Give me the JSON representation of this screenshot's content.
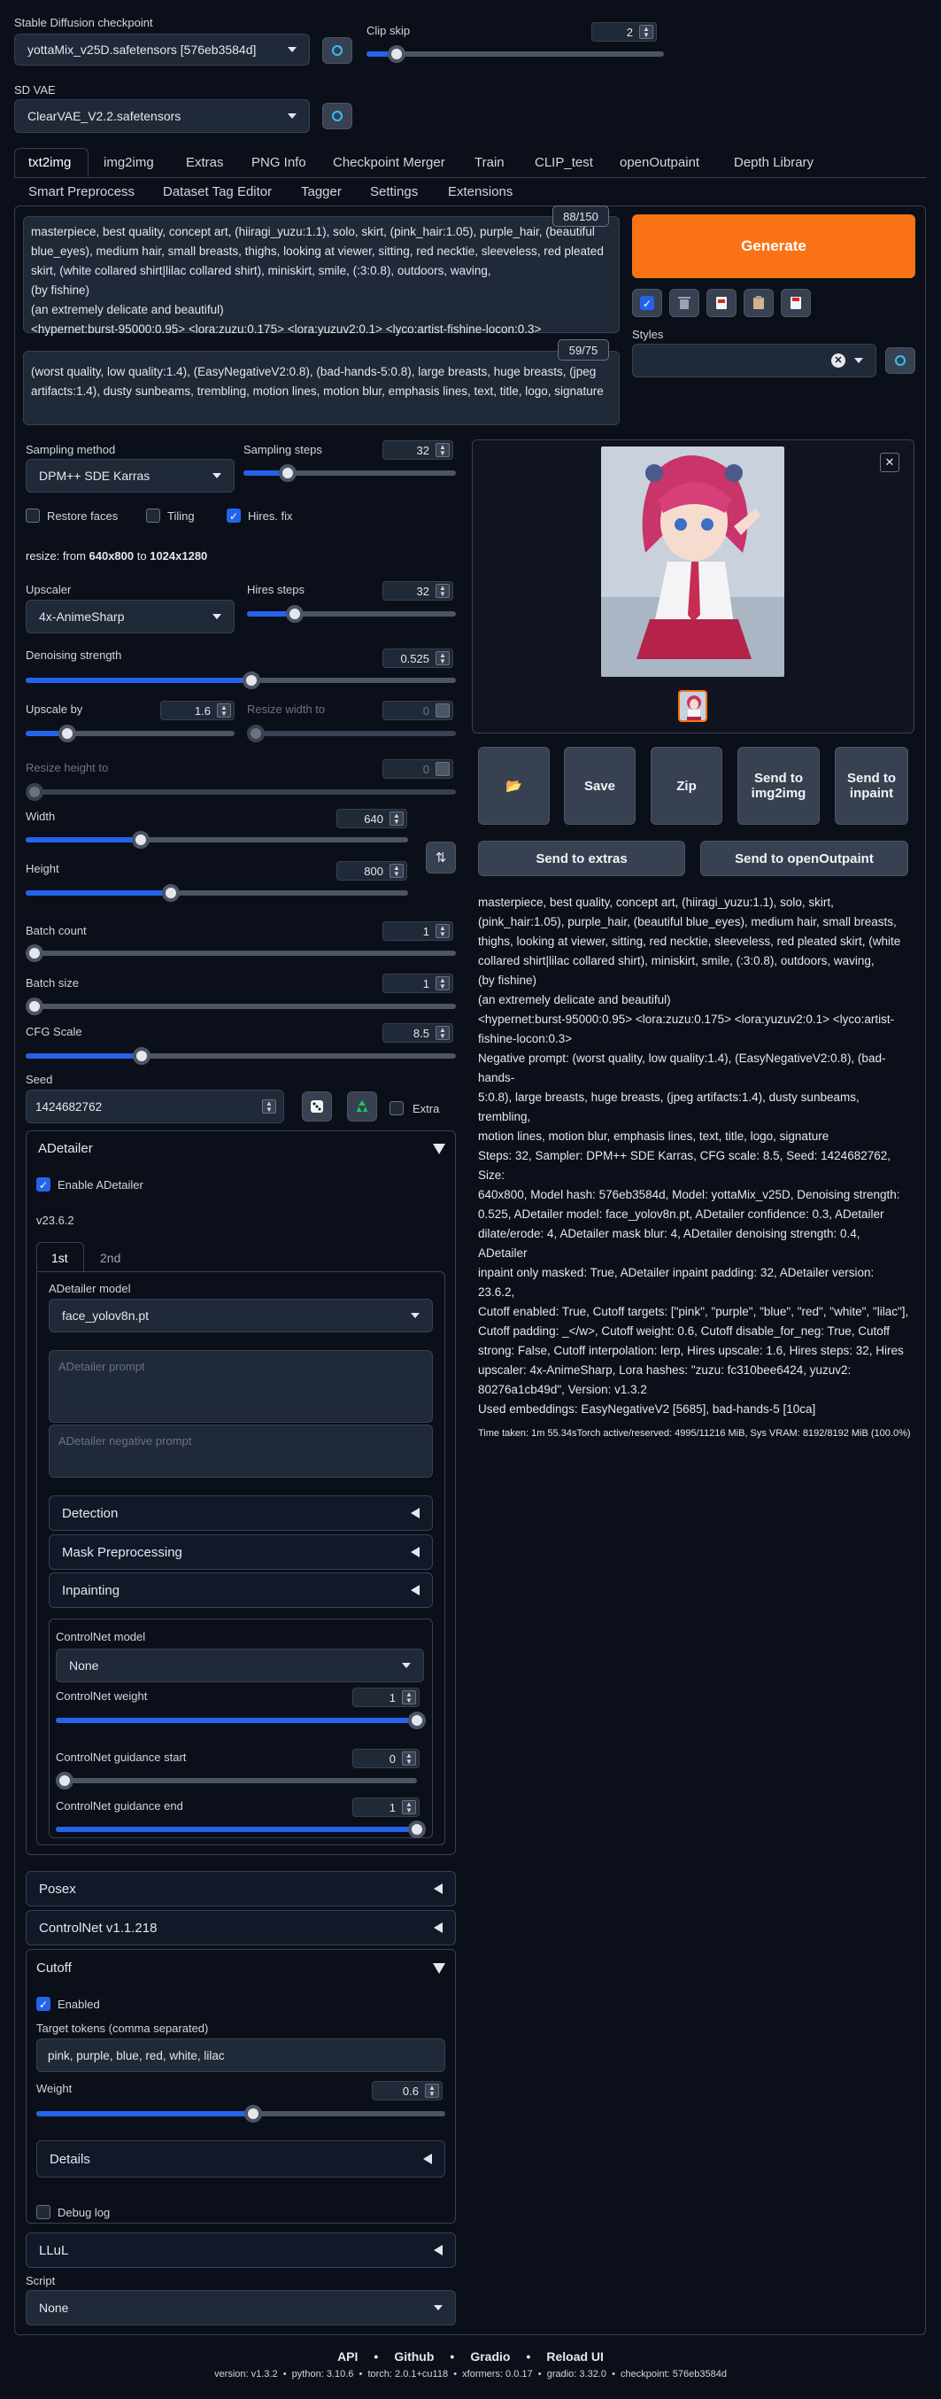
{
  "top": {
    "checkpoint_label": "Stable Diffusion checkpoint",
    "checkpoint_value": "yottaMix_v25D.safetensors [576eb3584d]",
    "clip_label": "Clip skip",
    "clip_value": "2",
    "clip_level": 0.1,
    "vae_label": "SD VAE",
    "vae_value": "ClearVAE_V2.2.safetensors"
  },
  "tabs": [
    "txt2img",
    "img2img",
    "Extras",
    "PNG Info",
    "Checkpoint Merger",
    "Train",
    "CLIP_test",
    "openOutpaint",
    "Depth Library",
    "Smart Preprocess",
    "Dataset Tag Editor",
    "Tagger",
    "Settings",
    "Extensions"
  ],
  "prompt": {
    "counter": "88/150",
    "lines": [
      "masterpiece, best quality, concept art, (hiiragi_yuzu:1.1), solo, skirt, (pink_hair:1.05), purple_hair, (beautiful",
      "blue_eyes), medium hair, small breasts, thighs, looking at viewer, sitting, red necktie, sleeveless, red pleated",
      "skirt, (white collared shirt|lilac collared shirt), miniskirt, smile, (:3:0.8), outdoors, waving,",
      "(by fishine)",
      "(an extremely delicate and beautiful)",
      "<hypernet:burst-95000:0.95> <lora:zuzu:0.175> <lora:yuzuv2:0.1> <lyco:artist-fishine-locon:0.3>"
    ]
  },
  "negative": {
    "counter": "59/75",
    "lines": [
      "(worst quality, low quality:1.4), (EasyNegativeV2:0.8), (bad-hands-5:0.8), large breasts, huge breasts, (jpeg",
      "artifacts:1.4), dusty sunbeams, trembling, motion lines, motion blur, emphasis lines, text, title, logo, signature"
    ]
  },
  "generate": "Generate",
  "styles_label": "Styles",
  "sampling": {
    "method_label": "Sampling method",
    "method_value": "DPM++ SDE Karras",
    "steps_label": "Sampling steps",
    "steps_value": "32",
    "steps_level": 0.21
  },
  "checks": {
    "restore": "Restore faces",
    "tiling": "Tiling",
    "hires": "Hires. fix"
  },
  "resize": {
    "prefix": "resize: from ",
    "from": "640x800",
    "mid": " to ",
    "to": "1024x1280"
  },
  "hires": {
    "upscaler_label": "Upscaler",
    "upscaler_value": "4x-AnimeSharp",
    "steps_label": "Hires steps",
    "steps_value": "32",
    "steps_level": 0.23,
    "denoise_label": "Denoising strength",
    "denoise_value": "0.525",
    "denoise_level": 0.525,
    "upscale_label": "Upscale by",
    "upscale_value": "1.6",
    "upscale_level": 0.2,
    "rw_label": "Resize width to",
    "rw_value": "0",
    "rh_label": "Resize height to",
    "rh_value": "0"
  },
  "size": {
    "width_label": "Width",
    "width_value": "640",
    "width_level": 0.3,
    "height_label": "Height",
    "height_value": "800",
    "height_level": 0.38
  },
  "batch": {
    "count_label": "Batch count",
    "count_value": "1",
    "size_label": "Batch size",
    "size_value": "1",
    "cfg_label": "CFG Scale",
    "cfg_value": "8.5",
    "cfg_level": 0.27
  },
  "seed": {
    "label": "Seed",
    "value": "1424682762",
    "extra": "Extra"
  },
  "adetailer": {
    "title": "ADetailer",
    "enable": "Enable ADetailer",
    "version": "v23.6.2",
    "tab1": "1st",
    "tab2": "2nd",
    "model_label": "ADetailer model",
    "model_value": "face_yolov8n.pt",
    "prompt_ph": "ADetailer prompt",
    "neg_ph": "ADetailer negative prompt",
    "detection": "Detection",
    "mask": "Mask Preprocessing",
    "inpaint": "Inpainting",
    "cn_model_label": "ControlNet model",
    "cn_model_value": "None",
    "cn_weight_label": "ControlNet weight",
    "cn_weight_value": "1",
    "cn_start_label": "ControlNet guidance start",
    "cn_start_value": "0",
    "cn_end_label": "ControlNet guidance end",
    "cn_end_value": "1"
  },
  "posex": "Posex",
  "controlnet": "ControlNet v1.1.218",
  "cutoff": {
    "title": "Cutoff",
    "enabled": "Enabled",
    "tokens_label": "Target tokens (comma separated)",
    "tokens_value": "pink, purple, blue, red, white, lilac",
    "weight_label": "Weight",
    "weight_value": "0.6",
    "weight_level": 0.53,
    "details": "Details",
    "debug": "Debug log"
  },
  "llul": "LLuL",
  "script": {
    "label": "Script",
    "value": "None"
  },
  "actions": {
    "folder": "📂",
    "save": "Save",
    "zip": "Zip",
    "img2img": "Send to img2img",
    "inpaint": "Send to inpaint",
    "extras": "Send to extras",
    "outpaint": "Send to openOutpaint"
  },
  "info": {
    "lines": [
      "masterpiece, best quality, concept art, (hiiragi_yuzu:1.1), solo, skirt,",
      "(pink_hair:1.05), purple_hair, (beautiful blue_eyes), medium hair, small breasts,",
      "thighs, looking at viewer, sitting, red necktie, sleeveless, red pleated skirt, (white",
      "collared shirt|lilac collared shirt), miniskirt, smile, (:3:0.8), outdoors, waving,",
      "(by fishine)",
      "(an extremely delicate and beautiful)",
      "<hypernet:burst-95000:0.95> <lora:zuzu:0.175> <lora:yuzuv2:0.1> <lyco:artist-",
      "fishine-locon:0.3>",
      "Negative prompt: (worst quality, low quality:1.4), (EasyNegativeV2:0.8), (bad-hands-",
      "5:0.8), large breasts, huge breasts, (jpeg artifacts:1.4), dusty sunbeams, trembling,",
      "motion lines, motion blur, emphasis lines, text, title, logo, signature",
      "Steps: 32, Sampler: DPM++ SDE Karras, CFG scale: 8.5, Seed: 1424682762, Size:",
      "640x800, Model hash: 576eb3584d, Model: yottaMix_v25D, Denoising strength:",
      "0.525, ADetailer model: face_yolov8n.pt, ADetailer confidence: 0.3, ADetailer",
      "dilate/erode: 4, ADetailer mask blur: 4, ADetailer denoising strength: 0.4, ADetailer",
      "inpaint only masked: True, ADetailer inpaint padding: 32, ADetailer version: 23.6.2,",
      "Cutoff enabled: True, Cutoff targets: [\"pink\", \"purple\", \"blue\", \"red\", \"white\", \"lilac\"],",
      "Cutoff padding: _</w>, Cutoff weight: 0.6, Cutoff disable_for_neg: True, Cutoff",
      "strong: False, Cutoff interpolation: lerp, Hires upscale: 1.6, Hires steps: 32, Hires",
      "upscaler: 4x-AnimeSharp, Lora hashes: \"zuzu: fc310bee6424, yuzuv2:",
      "80276a1cb49d\", Version: v1.3.2",
      "Used embeddings: EasyNegativeV2 [5685], bad-hands-5 [10ca]"
    ],
    "time": "Time taken: 1m 55.34sTorch active/reserved: 4995/11216 MiB, Sys VRAM: 8192/8192 MiB (100.0%)"
  },
  "footer": {
    "links": [
      "API",
      "Github",
      "Gradio",
      "Reload UI"
    ],
    "sep": "•",
    "version_line": "version: v1.3.2  •  python: 3.10.6  •  torch: 2.0.1+cu118  •  xformers: 0.0.17  •  gradio: 3.32.0  •  checkpoint: 576eb3584d"
  },
  "colors": {
    "accent": "#f97316",
    "blue": "#2563eb",
    "bg": "#0b0f19"
  }
}
